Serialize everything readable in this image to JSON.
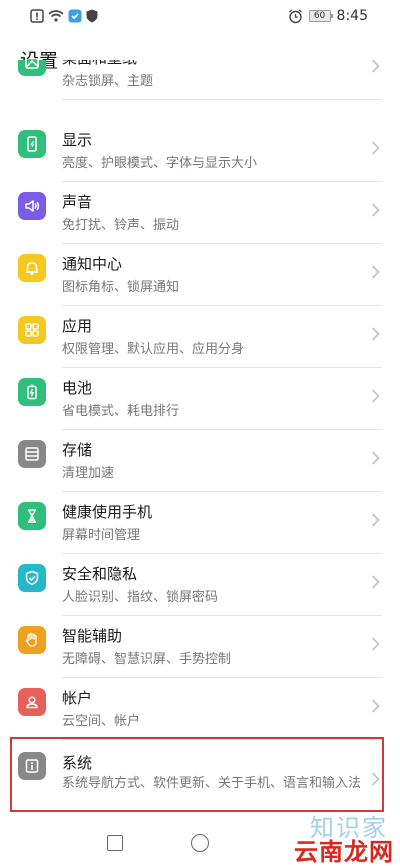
{
  "status_bar": {
    "battery": "60",
    "time": "8:45",
    "icons": [
      "warning-icon",
      "wifi-icon",
      "app-notification-icon",
      "shield-icon",
      "alarm-icon",
      "battery-icon"
    ]
  },
  "page": {
    "title": "设置"
  },
  "items": [
    {
      "title": "桌面和壁纸",
      "subtitle": "杂志锁屏、主题",
      "icon": "wallpaper-icon",
      "color": "#2fbf7a"
    },
    {
      "title": "显示",
      "subtitle": "亮度、护眼模式、字体与显示大小",
      "icon": "display-icon",
      "color": "#2fbf7a"
    },
    {
      "title": "声音",
      "subtitle": "免打扰、铃声、振动",
      "icon": "sound-icon",
      "color": "#7b5ce6"
    },
    {
      "title": "通知中心",
      "subtitle": "图标角标、锁屏通知",
      "icon": "bell-icon",
      "color": "#f5c81f"
    },
    {
      "title": "应用",
      "subtitle": "权限管理、默认应用、应用分身",
      "icon": "apps-icon",
      "color": "#f5c81f"
    },
    {
      "title": "电池",
      "subtitle": "省电模式、耗电排行",
      "icon": "battery-icon",
      "color": "#2fbf7a"
    },
    {
      "title": "存储",
      "subtitle": "清理加速",
      "icon": "storage-icon",
      "color": "#888888"
    },
    {
      "title": "健康使用手机",
      "subtitle": "屏幕时间管理",
      "icon": "hourglass-icon",
      "color": "#2fbf7a"
    },
    {
      "title": "安全和隐私",
      "subtitle": "人脸识别、指纹、锁屏密码",
      "icon": "shield-check-icon",
      "color": "#25b8c8"
    },
    {
      "title": "智能辅助",
      "subtitle": "无障碍、智慧识屏、手势控制",
      "icon": "hand-icon",
      "color": "#f0a020"
    },
    {
      "title": "帐户",
      "subtitle": "云空间、帐户",
      "icon": "account-icon",
      "color": "#e8605a"
    },
    {
      "title": "系统",
      "subtitle": "系统导航方式、软件更新、关于手机、语言和输入法",
      "icon": "info-icon",
      "color": "#888888"
    }
  ],
  "watermark": {
    "top": "知识家",
    "bottom": "云南龙网"
  }
}
